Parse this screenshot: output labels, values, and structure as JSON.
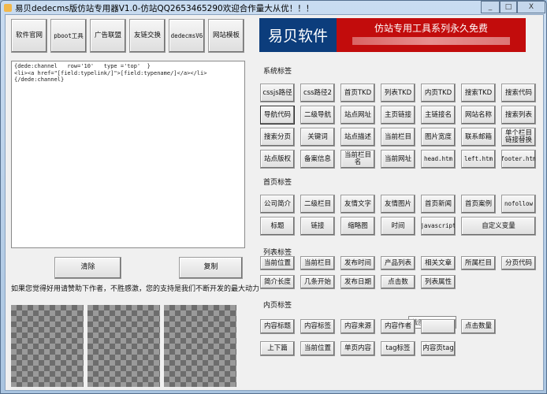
{
  "window": {
    "title": "易贝dedecms版仿站专用器V1.0-仿站QQ2653465290欢迎合作量大从优！！！",
    "controls": [
      "_",
      "□",
      "X"
    ]
  },
  "top_buttons": [
    "软件官网",
    "pboot工具",
    "广告联盟",
    "友链交换",
    "dedecmsV6",
    "网站模板"
  ],
  "banner": {
    "logo": "易贝软件",
    "slogan": "仿站专用工具系列永久免费"
  },
  "editor": {
    "value": "{dede:channel   row='10'   type ='top'  }\n<li><a href=\"[field:typelink/]\">[field:typename/]</a></li>\n{/dede:channel}"
  },
  "actions": {
    "clear": "清除",
    "copy": "复制"
  },
  "donate_text": "如果您觉得好用请赞助下作者，不胜感激，您的支持是我们不断开发的最大动力",
  "sections": {
    "system": {
      "label": "系统标签",
      "rows": [
        [
          "cssjs路径",
          "css路径2",
          "首页TKD",
          "列表TKD",
          "内页TKD",
          "搜索TKD",
          "搜索代码"
        ],
        [
          "导航代码",
          "二级导航",
          "站点网址",
          "主页链接",
          "主链接名",
          "网站名称",
          "搜索列表"
        ],
        [
          "搜索分页",
          "关键词",
          "站点描述",
          "当前栏目",
          "图片宽度",
          "联系邮箱",
          "单个栏目链接替换"
        ],
        [
          "站点版权",
          "备案信息",
          "当前栏目名",
          "当前网址",
          "head.htm",
          "left.htm",
          "footer.htm"
        ]
      ]
    },
    "home": {
      "label": "首页标签",
      "rows": [
        [
          "公司简介",
          "二级栏目",
          "友情文字",
          "友情图片",
          "首页新闻",
          "首页案例",
          "nofollow"
        ],
        [
          "标题",
          "链接",
          "缩略图",
          "时间",
          "javascript",
          "自定义变量"
        ]
      ]
    },
    "list": {
      "label": "列表标签",
      "rows": [
        [
          "当前位置",
          "当前栏目",
          "发布时间",
          "产品列表",
          "相关文章",
          "所属栏目",
          "分页代码"
        ],
        [
          "简介长度",
          "几条开始",
          "发布日期",
          "点击数",
          "列表属性"
        ]
      ]
    },
    "inner": {
      "label": "内页标签",
      "rows": [
        [
          "内容标题",
          "内容标签",
          "内容来源",
          "内容作者",
          "",
          "点击数量"
        ],
        [
          "上下篇",
          "当前位置",
          "单页内容",
          "tag标签",
          "内容页tag"
        ]
      ]
    }
  },
  "tooltip": "截图(Alt + A)"
}
